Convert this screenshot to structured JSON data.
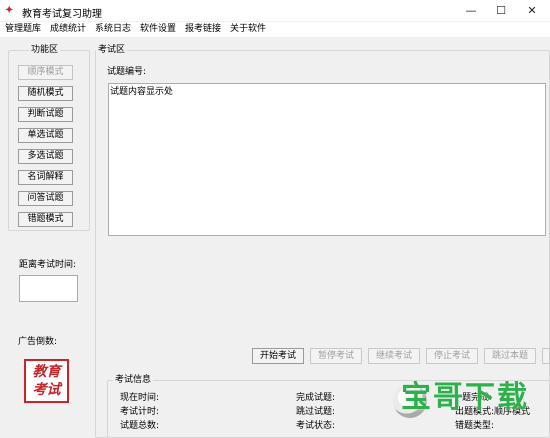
{
  "window": {
    "title": "教育考试复习助理",
    "app_icon": "app-icon",
    "controls": {
      "minimize": "—",
      "maximize": "☐",
      "close": "✕"
    }
  },
  "menu": {
    "items": [
      "管理题库",
      "成绩统计",
      "系统日志",
      "软件设置",
      "报考链接",
      "关于软件"
    ]
  },
  "sidebar": {
    "group_title": "功能区",
    "buttons": [
      {
        "label": "顺序模式",
        "enabled": false
      },
      {
        "label": "随机模式",
        "enabled": true
      },
      {
        "label": "判断试题",
        "enabled": true
      },
      {
        "label": "单选试题",
        "enabled": true
      },
      {
        "label": "多选试题",
        "enabled": true
      },
      {
        "label": "名词解释",
        "enabled": true
      },
      {
        "label": "问答试题",
        "enabled": true
      },
      {
        "label": "错题模式",
        "enabled": true
      }
    ],
    "countdown_label": "距离考试时间:",
    "countdown_value": "",
    "ad_label": "广告倒数:",
    "ad_seal": "教育考试"
  },
  "exam": {
    "group_title": "考试区",
    "question_number_label": "试题编号:",
    "question_content": "试题内容显示处",
    "buttons": [
      {
        "label": "开始考试",
        "enabled": true
      },
      {
        "label": "暂停考试",
        "enabled": false
      },
      {
        "label": "继续考试",
        "enabled": false
      },
      {
        "label": "停止考试",
        "enabled": false
      },
      {
        "label": "跳过本题",
        "enabled": false
      }
    ]
  },
  "info": {
    "group_title": "考试信息",
    "col1": [
      "现在时间:",
      "考试计时:",
      "试题总数:"
    ],
    "col2": [
      "完成试题:",
      "跳过试题:",
      "考试状态:"
    ],
    "col3": [
      "题完成:",
      "出题模式:顺序模式",
      "错题类型:"
    ]
  },
  "watermark": {
    "text": "宝哥下载"
  },
  "colors": {
    "seal_red": "#c4262c",
    "watermark_green": "#2db14a"
  }
}
